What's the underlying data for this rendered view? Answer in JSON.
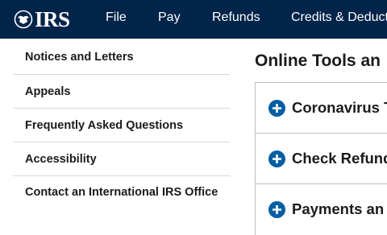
{
  "header": {
    "logo_text": "IRS",
    "nav": [
      {
        "label": "File"
      },
      {
        "label": "Pay"
      },
      {
        "label": "Refunds"
      },
      {
        "label": "Credits & Deductio"
      }
    ]
  },
  "sidebar": {
    "items": [
      {
        "label": "Notices and Letters"
      },
      {
        "label": "Appeals"
      },
      {
        "label": "Frequently Asked Questions"
      },
      {
        "label": "Accessibility"
      },
      {
        "label": "Contact an International IRS Office"
      }
    ]
  },
  "main": {
    "title": "Online Tools an",
    "accordion": [
      {
        "label": "Coronavirus T"
      },
      {
        "label": "Check Refund"
      },
      {
        "label": "Payments an"
      }
    ]
  },
  "colors": {
    "header_bg": "#00244a",
    "accent": "#005ea2"
  },
  "icons": {
    "logo": "irs-eagle-logo-icon",
    "accordion": "plus-circle-icon"
  }
}
